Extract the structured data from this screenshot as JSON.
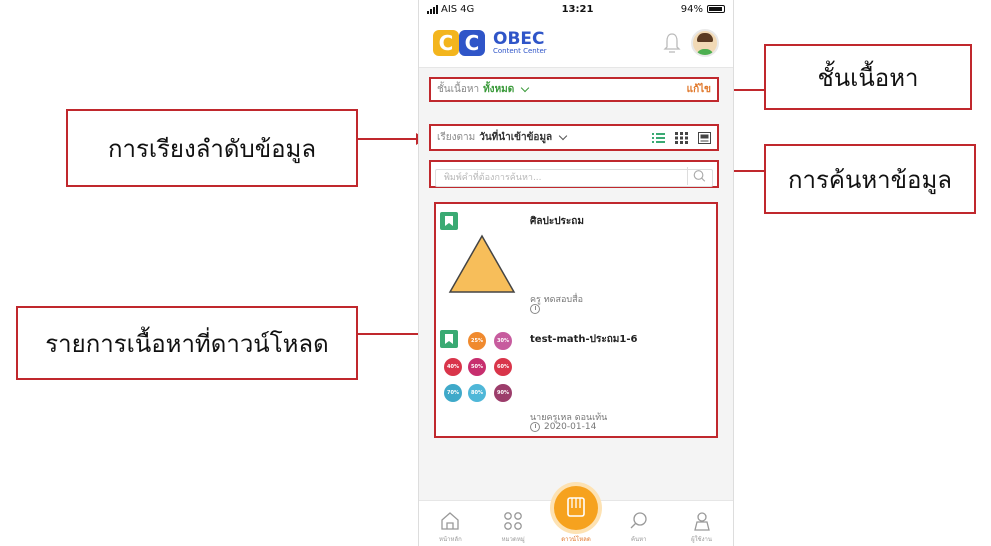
{
  "status_bar": {
    "carrier": "AIS",
    "network": "4G",
    "time": "13:21",
    "battery": "94%"
  },
  "app": {
    "logo_title": "OBEC",
    "logo_subtitle": "Content Center",
    "avatar": "user-avatar"
  },
  "level_filter": {
    "label": "ชั้นเนื้อหา",
    "value": "ทั้งหมด",
    "edit_label": "แก้ไข"
  },
  "sort": {
    "label": "เรียงตาม",
    "value": "วันที่นำเข้าข้อมูล"
  },
  "search": {
    "placeholder": "พิมพ์คำที่ต้องการค้นหา..."
  },
  "items": [
    {
      "title": "ศิลปะประถม",
      "author": "ครู ทดสอบสื่อ",
      "date": ""
    },
    {
      "title": "test-math-ประถม1-6",
      "author": "นายครูเหล ดอนเท้น",
      "date": "2020-01-14",
      "thumb_labels": [
        "25%",
        "30%",
        "40%",
        "50%",
        "60%",
        "70%",
        "80%",
        "90%"
      ]
    }
  ],
  "tabbar": {
    "items": [
      "หน้าหลัก",
      "หมวดหมู่",
      "ดาวน์โหลด",
      "ค้นหา",
      "ผู้ใช้งาน"
    ]
  },
  "callouts": {
    "level": "ชั้นเนื้อหา",
    "sort": "การเรียงลำดับข้อมูล",
    "search": "การค้นหาข้อมูล",
    "downloads": "รายการเนื้อหาที่ดาวน์โหลด"
  },
  "colors": {
    "accent": "#c0282d",
    "brand_blue": "#2f55c8",
    "brand_yellow": "#f3b51d",
    "green": "#3aaa73",
    "orange": "#f6a21e"
  }
}
